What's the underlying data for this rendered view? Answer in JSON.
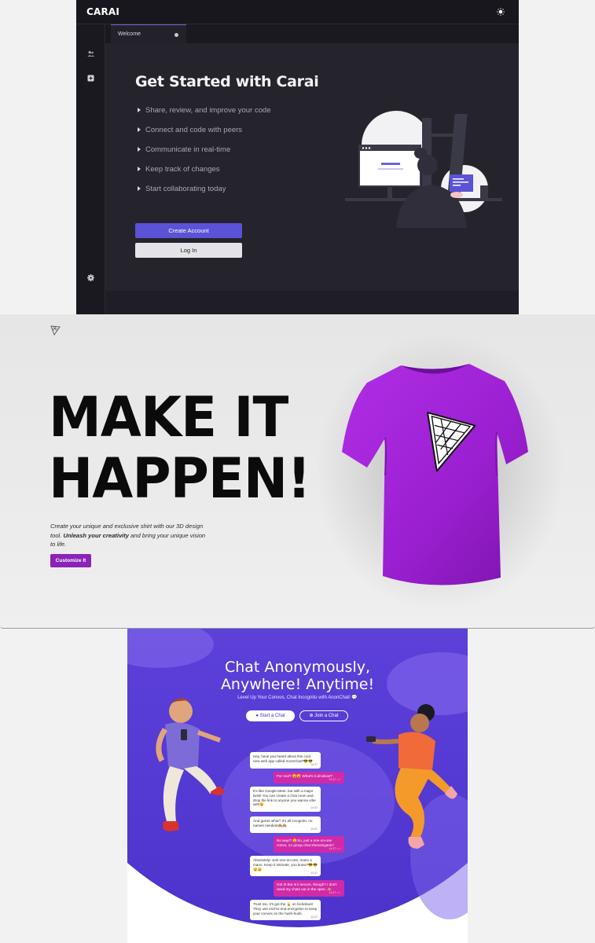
{
  "carai": {
    "brand": "CARAI",
    "tab": "Welcome",
    "heading": "Get Started with Carai",
    "features": [
      "Share, review, and improve your code",
      "Connect and code with peers",
      "Communicate in real-time",
      "Keep track of changes",
      "Start collaborating today"
    ],
    "create_account": "Create Account",
    "login": "Log In",
    "colors": {
      "accent": "#5b53d6",
      "bg": "#25242d"
    }
  },
  "shirt": {
    "headline_line1": "MAKE IT",
    "headline_line2": "HAPPEN!",
    "desc_a": "Create your unique and exclusive shirt with our 3D design tool. ",
    "desc_bold": "Unleash your creativity",
    "desc_b": " and bring your unique vision to life.",
    "customize": "Customize It",
    "colors": {
      "shirt": "#9a1fd0",
      "button": "#8a23b8"
    }
  },
  "anon": {
    "title_line1": "Chat Anonymously,",
    "title_line2": "Anywhere! Anytime!",
    "subtitle": "Level Up Your Convos, Chat Incognito with AnonChat! 💬",
    "start_chat": "Start a Chat",
    "join_chat": "Join a Chat",
    "messages": [
      {
        "text": "Hey, have you heard about this cool new web app called AnonChat?😎😎",
        "time": "14:37"
      },
      {
        "text": "For real? 😮😮 What's it all about?",
        "time": "14:37 ✓✓"
      },
      {
        "text": "It's like Google Meet, but with a major twist! You can create a chat room and drop the link to anyone you wanna vibe with😉",
        "time": "14:37"
      },
      {
        "text": "And guess what? It's all incognito, no names needed!🙈🙈",
        "time": "14:37"
      },
      {
        "text": "No way!? 😲So, just a one-on-one convo, no group chat shenanigans?",
        "time": "14:37 ✓✓"
      },
      {
        "text": "Absolutely! Just one-on-one, mano a mano. Keep it intimate, you know?😎😎😉😉",
        "time": "14:37"
      },
      {
        "text": "Got it! But is it secure, though? I don't need my chats out in the open. 🙈",
        "time": "14:37 ✓✓"
      },
      {
        "text": "Trust me, it's got the 🔒 on lockdown! They use end-to-end encryption to keep your convos on the hush-hush.",
        "time": "14:37"
      }
    ],
    "colors": {
      "primary": "#5b3fd8",
      "outgoing": "#d12aa8"
    }
  }
}
